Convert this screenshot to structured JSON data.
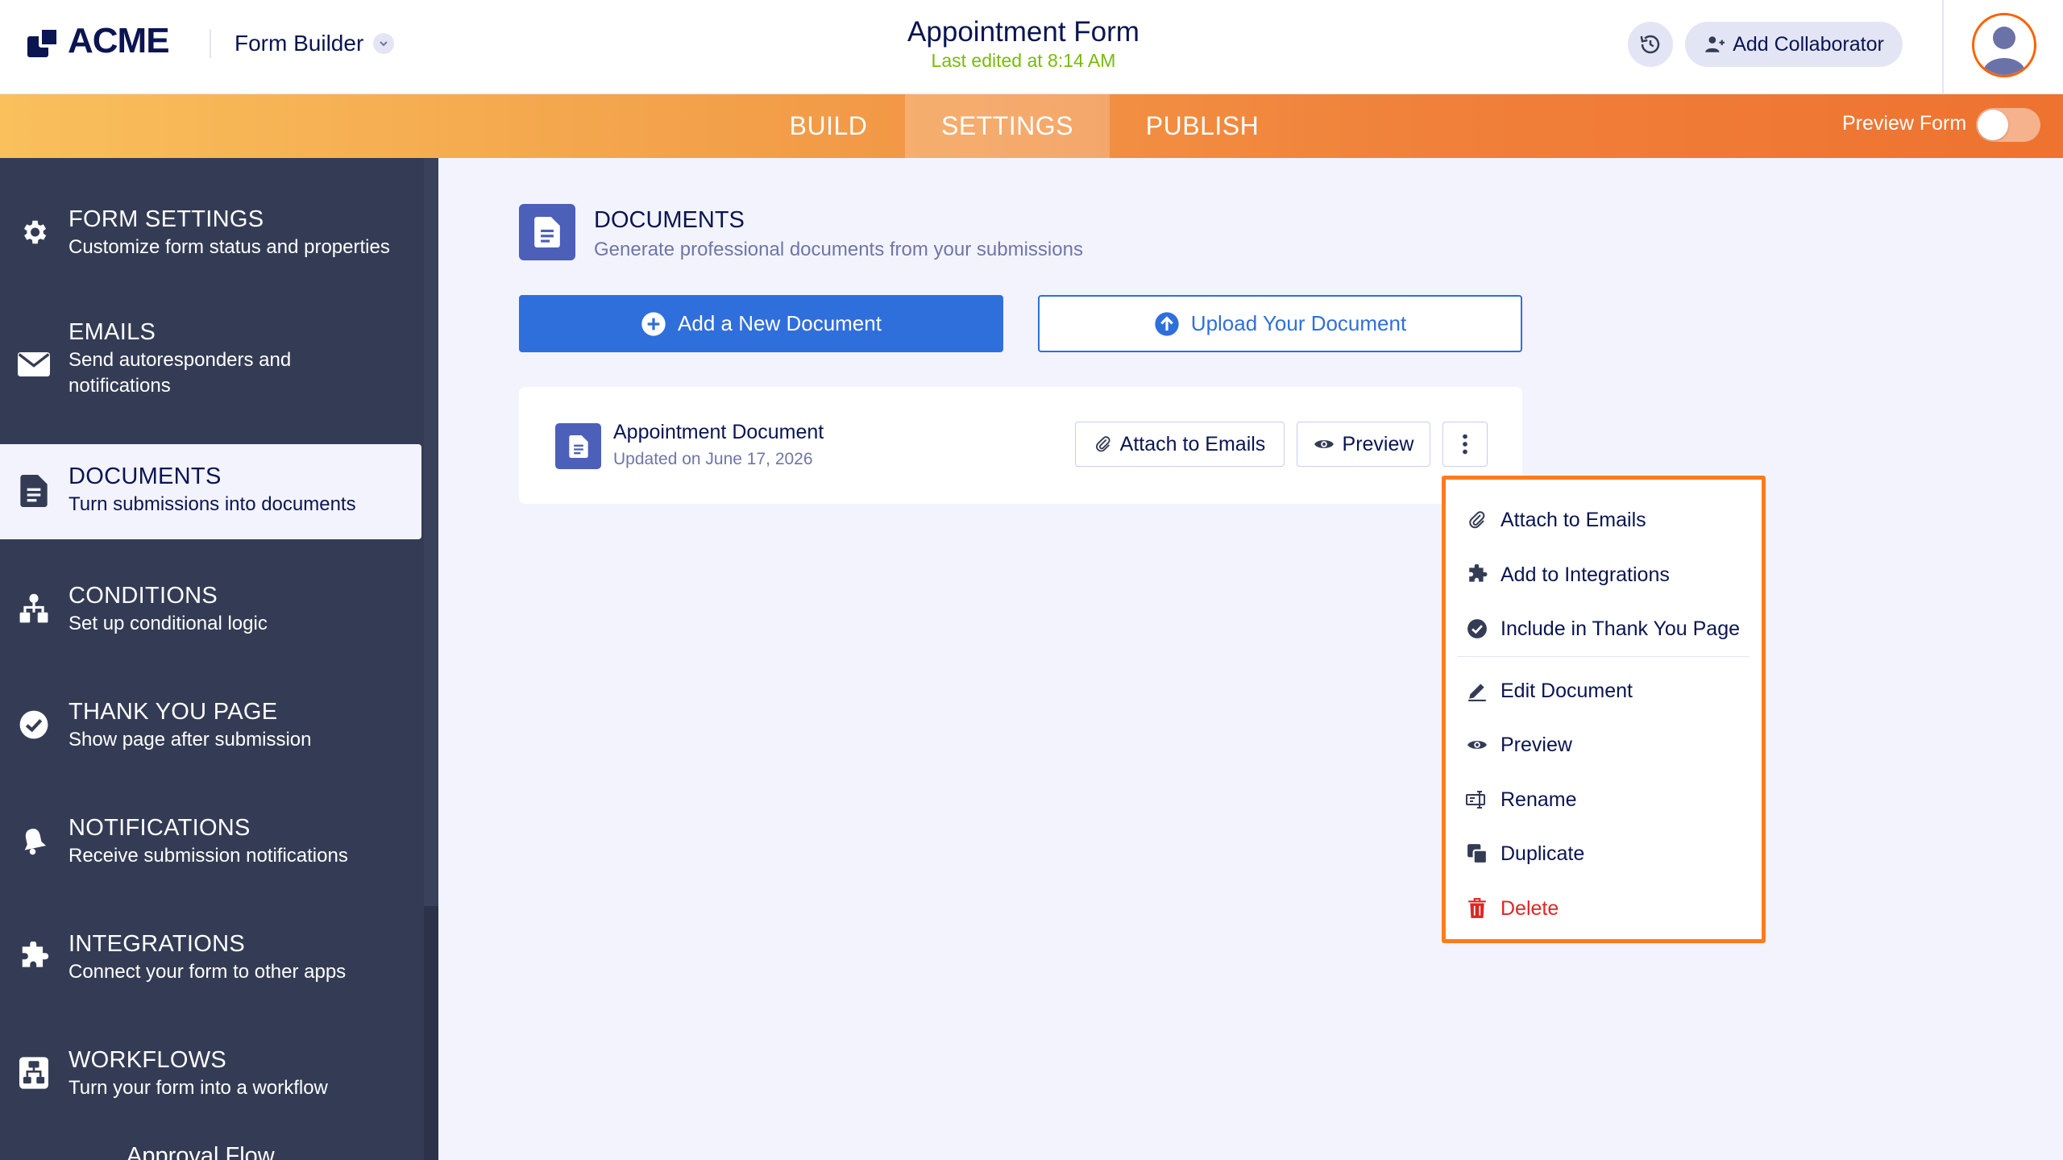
{
  "header": {
    "logo_text": "ACME",
    "app_name": "Form Builder",
    "form_title": "Appointment Form",
    "last_edited": "Last edited at 8:14 AM",
    "add_collaborator": "Add Collaborator"
  },
  "nav": {
    "tabs": [
      {
        "label": "BUILD",
        "active": false
      },
      {
        "label": "SETTINGS",
        "active": true
      },
      {
        "label": "PUBLISH",
        "active": false
      }
    ],
    "preview_form": "Preview Form",
    "preview_toggle_on": false
  },
  "sidebar": {
    "items": [
      {
        "title": "FORM SETTINGS",
        "sub": "Customize form status and properties",
        "icon": "gear-icon"
      },
      {
        "title": "EMAILS",
        "sub": "Send autoresponders and notifications",
        "icon": "envelope-icon"
      },
      {
        "title": "DOCUMENTS",
        "sub": "Turn submissions into documents",
        "icon": "document-icon",
        "active": true
      },
      {
        "title": "CONDITIONS",
        "sub": "Set up conditional logic",
        "icon": "sitemap-icon"
      },
      {
        "title": "THANK YOU PAGE",
        "sub": "Show page after submission",
        "icon": "check-circle-icon"
      },
      {
        "title": "NOTIFICATIONS",
        "sub": "Receive submission notifications",
        "icon": "bell-icon"
      },
      {
        "title": "INTEGRATIONS",
        "sub": "Connect your form to other apps",
        "icon": "puzzle-icon"
      },
      {
        "title": "WORKFLOWS",
        "sub": "Turn your form into a workflow",
        "icon": "workflow-icon"
      }
    ],
    "overflow_label": "Approval Flow"
  },
  "documents": {
    "title": "DOCUMENTS",
    "subtitle": "Generate professional documents from your submissions",
    "add_button": "Add a New Document",
    "upload_button": "Upload Your Document",
    "card": {
      "name": "Appointment Document",
      "updated": "Updated on June 17, 2026",
      "attach_button": "Attach to Emails",
      "preview_button": "Preview"
    }
  },
  "menu": {
    "items": [
      {
        "label": "Attach to Emails",
        "icon": "paperclip-icon"
      },
      {
        "label": "Add to Integrations",
        "icon": "puzzle-icon"
      },
      {
        "label": "Include in Thank You Page",
        "icon": "check-circle-icon"
      },
      {
        "label": "Edit Document",
        "icon": "pencil-icon"
      },
      {
        "label": "Preview",
        "icon": "eye-icon"
      },
      {
        "label": "Rename",
        "icon": "rename-icon"
      },
      {
        "label": "Duplicate",
        "icon": "duplicate-icon"
      },
      {
        "label": "Delete",
        "icon": "trash-icon",
        "danger": true
      }
    ]
  },
  "colors": {
    "primary": "#2f6fdb",
    "navy": "#0a1551",
    "sidebar": "#343c55",
    "accent_orange": "#ff7b1c",
    "edited_green": "#78bb07",
    "danger": "#dc2626"
  }
}
